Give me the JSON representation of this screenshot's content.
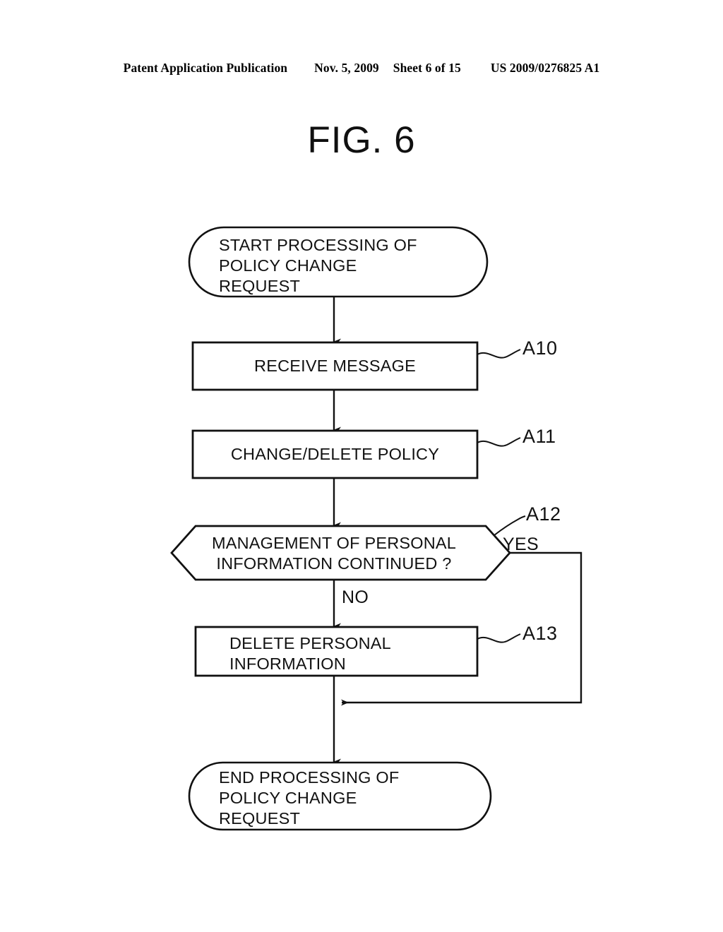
{
  "header": {
    "publication": "Patent Application Publication",
    "date": "Nov. 5, 2009",
    "sheet": "Sheet 6 of 15",
    "doc_number": "US 2009/0276825 A1"
  },
  "figure": {
    "title": "FIG. 6"
  },
  "flowchart": {
    "start": {
      "label": "START PROCESSING OF\nPOLICY CHANGE\nREQUEST",
      "shape": "terminator"
    },
    "steps": [
      {
        "id": "A10",
        "label": "RECEIVE MESSAGE",
        "ref": "A10",
        "shape": "process"
      },
      {
        "id": "A11",
        "label": "CHANGE/DELETE POLICY",
        "ref": "A11",
        "shape": "process"
      },
      {
        "id": "A12",
        "label": "MANAGEMENT OF PERSONAL\nINFORMATION CONTINUED ?",
        "ref": "A12",
        "shape": "decision",
        "branch_yes": "YES",
        "branch_no": "NO"
      },
      {
        "id": "A13",
        "label": "DELETE PERSONAL\nINFORMATION",
        "ref": "A13",
        "shape": "process"
      }
    ],
    "end": {
      "label": "END PROCESSING OF\nPOLICY CHANGE\nREQUEST",
      "shape": "terminator"
    },
    "colors": {
      "stroke": "#111111",
      "fill": "#ffffff",
      "background": "#ffffff"
    }
  }
}
